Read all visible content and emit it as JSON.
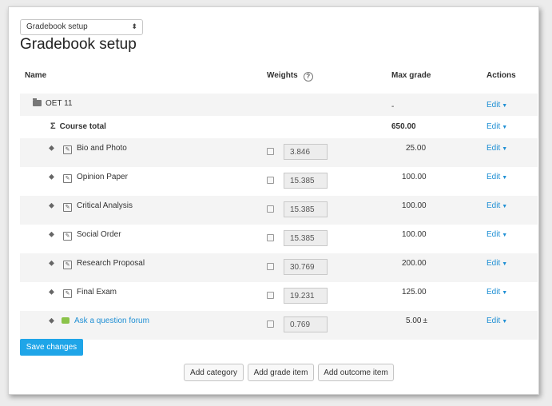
{
  "page": {
    "select_value": "Gradebook setup",
    "title": "Gradebook setup"
  },
  "table": {
    "headers": {
      "name": "Name",
      "weights": "Weights",
      "max": "Max grade",
      "actions": "Actions"
    },
    "category": {
      "name": "OET 11",
      "max": "-",
      "action": "Edit"
    },
    "total": {
      "name": "Course total",
      "max": "650.00",
      "action": "Edit"
    },
    "items": [
      {
        "name": "Bio and Photo",
        "weight": "3.846",
        "max": "25.00",
        "action": "Edit"
      },
      {
        "name": "Opinion Paper",
        "weight": "15.385",
        "max": "100.00",
        "action": "Edit"
      },
      {
        "name": "Critical Analysis",
        "weight": "15.385",
        "max": "100.00",
        "action": "Edit"
      },
      {
        "name": "Social Order",
        "weight": "15.385",
        "max": "100.00",
        "action": "Edit"
      },
      {
        "name": "Research Proposal",
        "weight": "30.769",
        "max": "200.00",
        "action": "Edit"
      },
      {
        "name": "Final Exam",
        "weight": "19.231",
        "max": "125.00",
        "action": "Edit"
      },
      {
        "name": "Ask a question forum",
        "weight": "0.769",
        "max": "5.00",
        "action": "Edit"
      }
    ]
  },
  "buttons": {
    "save": "Save changes",
    "add_category": "Add category",
    "add_grade_item": "Add grade item",
    "add_outcome_item": "Add outcome item"
  }
}
